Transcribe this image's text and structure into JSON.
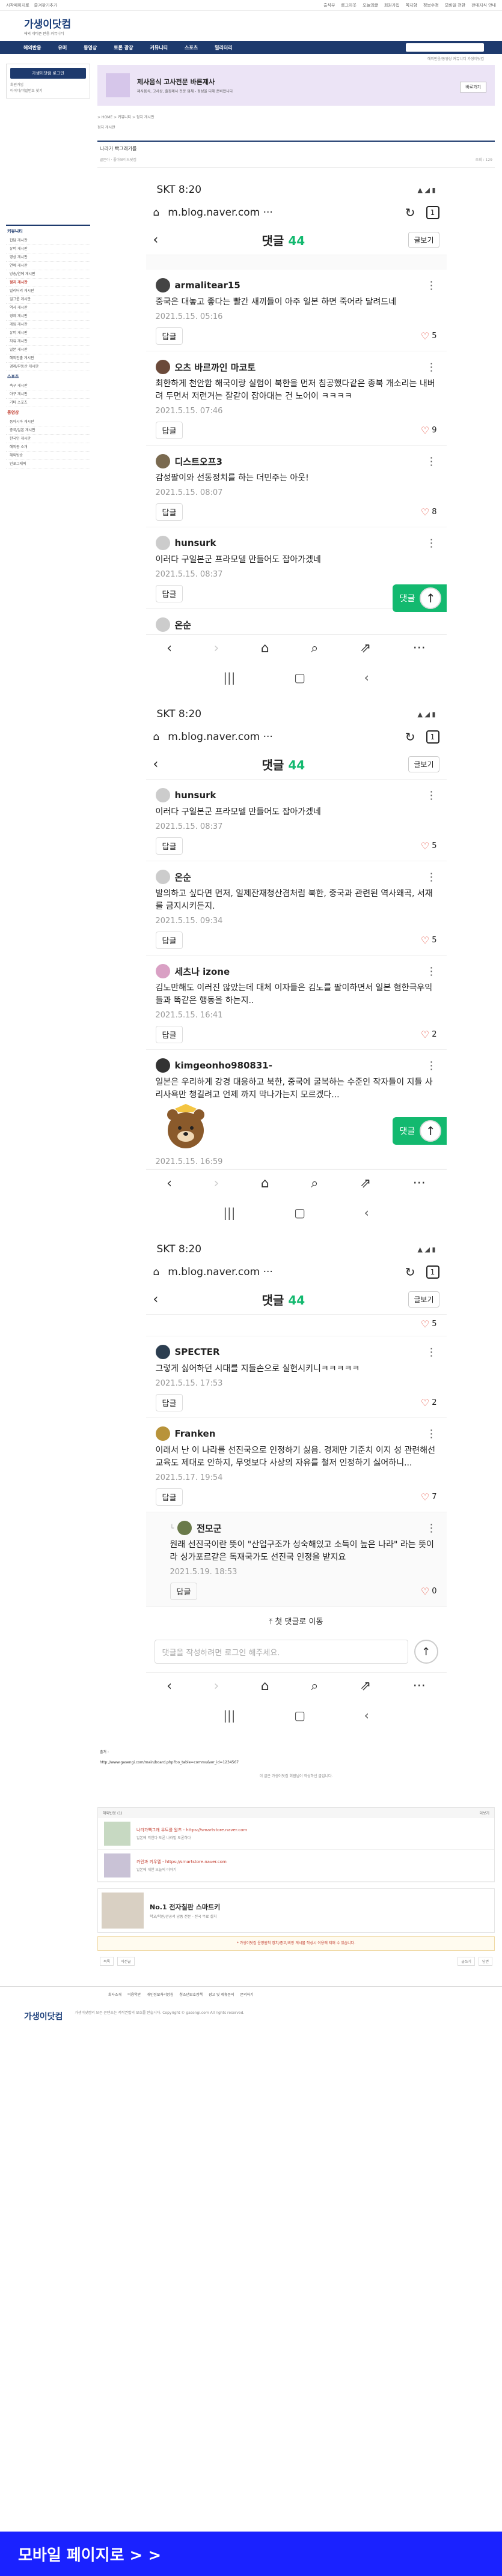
{
  "util_bar": {
    "left": [
      "시작페이지로",
      "즐겨찾기추가"
    ],
    "right": [
      "출석부",
      "로그아웃",
      "오늘의글",
      "회원가입",
      "쪽지함",
      "정보수정",
      "모바일 전환",
      "판매지식 안내"
    ]
  },
  "site": {
    "logo": "가생이닷컴",
    "logo_sub": "해외 네티즌 반응 커뮤니티",
    "gnb": [
      "해외반응",
      "유머",
      "동영상",
      "토론 광장",
      "커뮤니티",
      "스포츠",
      "밀리터리"
    ],
    "subgnb": "해외반응/동영상 커뮤니티 가생이닷컴"
  },
  "sidebar": {
    "login_button": "가생이닷컴 로그인",
    "links": [
      "회원가입",
      "아이디/비밀번호 찾기"
    ],
    "menu_head": "커뮤니티",
    "menu_items": [
      "잡담 게시판",
      "유머 게시판",
      "영상 게시판",
      "연예 게시판",
      "방송/연예 게시판",
      "정치 게시판",
      "밀리터리 게시판",
      "걸그룹 게시판",
      "역사 게시판",
      "경제 게시판",
      "게임 게시판",
      "유머 게시판",
      "자유 게시판",
      "일본 게시판",
      "해외진출 게시판",
      "경제/부동산 게시판"
    ],
    "menu_head2": "스포츠",
    "menu_items2": [
      "축구 게시판",
      "야구 게시판",
      "기타 스포츠"
    ],
    "menu_head3": "동영상",
    "menu_items3": [
      "동아시아 게시판",
      "중국/일본 게시판",
      "한국인 게시판",
      "해외동 소개",
      "해외방송",
      "인포그래픽"
    ]
  },
  "ad": {
    "title": "제사음식 고사전문 바른제사",
    "desc": "제사음식, 고사상, 출장제사 전문 업체 - 정성을 다해 준비합니다",
    "button": "바로가기"
  },
  "board": {
    "path": "> HOME > 커뮤니티 > 정치 게시판",
    "title": "나라가 빡그래가를",
    "category": "정치 게시판",
    "author": "골든아 · 좋아요이드닷컴",
    "meta_right": "조회 : 129",
    "tools": [
      "추천",
      "스크랩"
    ]
  },
  "phone1": {
    "time": "SKT 8:20",
    "url": "m.blog.naver.com ···",
    "tab_count": "1",
    "title": "댓글",
    "count": "44",
    "write": "글보기",
    "comments": [
      {
        "nick": "armalitear15",
        "text": "중국은 대놓고 좋다는 빨간 새끼들이 아주 일본 하면 죽어라 달려드네",
        "date": "2021.5.15. 05:16",
        "likes": "5"
      },
      {
        "nick": "오츠 바르까인 마코토",
        "text": "최한하게 천안함 해국이랑 실험이 북한을 먼저 침공했다같은 종북 개소리는 내버려 두면서 저런거는 잘같이 잡아대는 건 노어이 ㅋㅋㅋㅋ",
        "date": "2021.5.15. 07:46",
        "likes": "9"
      },
      {
        "nick": "디스트오프3",
        "text": "감성팔이와 선동정치를 하는 더민주는 아웃!",
        "date": "2021.5.15. 08:07",
        "likes": "8"
      },
      {
        "nick": "hunsurk",
        "text": "이러다 구일본군 프라모델 만들어도 잡아가겠네",
        "date": "2021.5.15. 08:37",
        "likes": ""
      },
      {
        "nick": "온순",
        "text": "",
        "date": "",
        "likes": ""
      }
    ],
    "reply_float": "댓글"
  },
  "phone2": {
    "time": "SKT 8:20",
    "url": "m.blog.naver.com ···",
    "tab_count": "1",
    "title": "댓글",
    "count": "44",
    "write": "글보기",
    "comments": [
      {
        "nick": "hunsurk",
        "text": "이러다 구일본군 프라모델 만들어도 잡아가겠네",
        "date": "2021.5.15. 08:37",
        "likes": "5"
      },
      {
        "nick": "온순",
        "text": "발의하고 싶다면 먼저, 일제잔재청산겸처럼 북한, 중국과 관련된 역사왜곡, 서재를 금지시키든지.",
        "date": "2021.5.15. 09:34",
        "likes": "5"
      },
      {
        "nick": "세츠나 izone",
        "text": "김노만해도 이러진 않았는데 대체 이자들은 김노를 팔이하면서 일본 혐한극우익들과 똑같은 행동을 하는지..",
        "date": "2021.5.15. 16:41",
        "likes": "2"
      },
      {
        "nick": "kimgeonho980831-",
        "text": "일본은 우리하게 강경 대응하고 북한, 중국에 굴복하는 수준인 작자들이 지들 사리사욕만 챙길려고 언제 까지 막나가는지 모르겠다...",
        "date": "2021.5.15. 16:59",
        "likes": ""
      }
    ],
    "reply_float": "댓글"
  },
  "phone3": {
    "time": "SKT 8:20",
    "url": "m.blog.naver.com ···",
    "tab_count": "1",
    "title": "댓글",
    "count": "44",
    "write": "글보기",
    "top_likes": "5",
    "comments": [
      {
        "nick": "SPECTER",
        "text": "그렇게 싫어하던 시대를 지들손으로 실현시키니ㅋㅋㅋㅋㅋ",
        "date": "2021.5.15. 17:53",
        "likes": "2"
      },
      {
        "nick": "Franken",
        "text": "이래서 난 이 나라를 선진국으로 인정하기 싫음. 경제만 기준치 이지 성 관련해선 교육도 제대로 안하지, 무엇보다 사상의 자유를 철저 인정하기 싫어하니...",
        "date": "2021.5.17. 19:54",
        "likes": "7"
      }
    ],
    "reply": {
      "nick": "전모군",
      "text": "원래 선진국이란 뜻이 \"산업구조가 성숙해있고 소득이 높은 나라\" 라는 뜻이라 싱가포르같은 독재국가도 선진국 인정을 받지요",
      "date": "2021.5.19. 18:53",
      "likes": "0"
    },
    "reply_next": "첫 댓글로 이동",
    "input_placeholder": "댓글을 작성하려면 로그인 해주세요."
  },
  "post_bottom": {
    "source_label": "출처 :",
    "source_link": "http://www.gasengi.com/main/board.php?bo_table=commu&wr_id=1234567",
    "disclaimer": "이 글은 가생이닷컴 회원님이 작성하신 글입니다.",
    "related_head_left": "해외반응 (1)",
    "related_head_right": "더보기",
    "related": [
      {
        "title": "나라가빡그래 우트를 원츠 - https://smartstore.naver.com",
        "desc": "일본에 먹힌다 토론 나라말 토론하다"
      },
      {
        "title": "카인과 키우엘 - https://smartstore.naver.com",
        "desc": "일본에 대한 오늘의 이야기"
      }
    ],
    "promo_title": "No.1 전자칠판 스마트키",
    "promo_desc": "학교/학원/관공서 납품 전문 - 전국 무료 설치",
    "warn": "* 가생이닷컴 운영원칙\n정치/종교/비방 게시물 작성시 이용에 제재 수 있습니다.",
    "tools_left": [
      "목록",
      "이전글"
    ],
    "tools_right": [
      "글쓰기",
      "답변"
    ],
    "footer": [
      "회사소개",
      "이용약관",
      "개인정보처리방침",
      "청소년보호정책",
      "광고 및 제휴문의",
      "문의하기"
    ],
    "footer_logo": "가생이닷컴",
    "footer_info": "가생이닷컴의 모든 콘텐츠는 저작권법의 보호를 받습니다.\nCopyright © gasengi.com All rights reserved.",
    "mobile_button": "모바일 페이지로 > >"
  }
}
